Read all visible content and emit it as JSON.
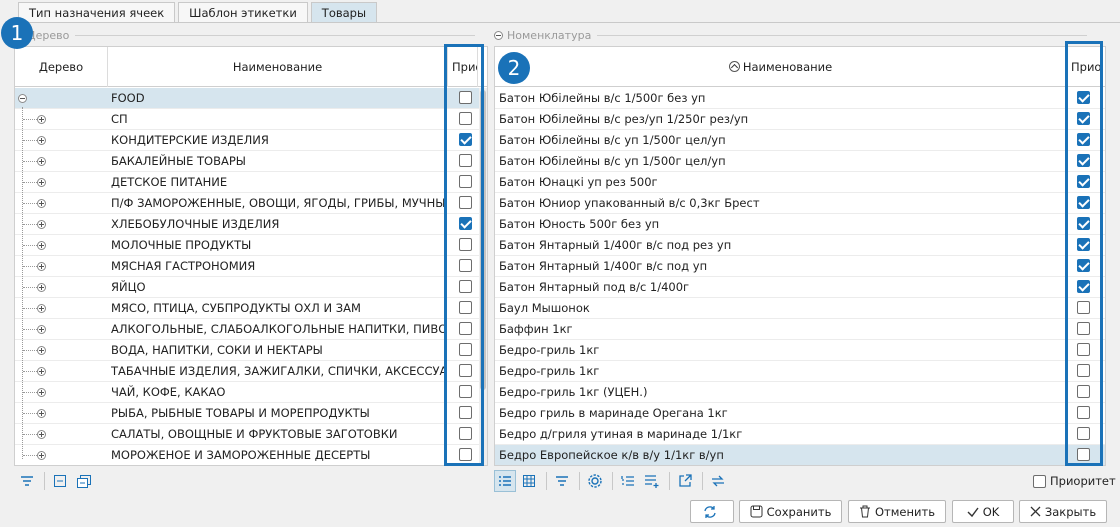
{
  "tabs": [
    {
      "label": "Тип назначения ячеек",
      "active": false
    },
    {
      "label": "Шаблон этикетки",
      "active": false
    },
    {
      "label": "Товары",
      "active": true
    }
  ],
  "badges": [
    "1",
    "2"
  ],
  "left_panel": {
    "legend": "Дерево",
    "columns": {
      "tree": "Дерево",
      "name": "Наименование",
      "priority": "Прио"
    },
    "rows": [
      {
        "name": "FOOD",
        "checked": false,
        "expanded": true
      },
      {
        "name": "СП",
        "checked": false
      },
      {
        "name": "КОНДИТЕРСКИЕ ИЗДЕЛИЯ",
        "checked": true
      },
      {
        "name": "БАКАЛЕЙНЫЕ ТОВАРЫ",
        "checked": false
      },
      {
        "name": "ДЕТСКОЕ ПИТАНИЕ",
        "checked": false
      },
      {
        "name": "П/Ф ЗАМОРОЖЕННЫЕ, ОВОЩИ, ЯГОДЫ, ГРИБЫ, МУЧНЫЕ",
        "checked": false
      },
      {
        "name": "ХЛЕБОБУЛОЧНЫЕ ИЗДЕЛИЯ",
        "checked": true
      },
      {
        "name": "МОЛОЧНЫЕ ПРОДУКТЫ",
        "checked": false
      },
      {
        "name": "МЯСНАЯ ГАСТРОНОМИЯ",
        "checked": false
      },
      {
        "name": "ЯЙЦО",
        "checked": false
      },
      {
        "name": "МЯСО, ПТИЦА, СУБПРОДУКТЫ ОХЛ И ЗАМ",
        "checked": false
      },
      {
        "name": "АЛКОГОЛЬНЫЕ, СЛАБОАЛКОГОЛЬНЫЕ НАПИТКИ, ПИВО",
        "checked": false
      },
      {
        "name": "ВОДА, НАПИТКИ, СОКИ И НЕКТАРЫ",
        "checked": false
      },
      {
        "name": "ТАБАЧНЫЕ ИЗДЕЛИЯ, ЗАЖИГАЛКИ, СПИЧКИ, АКСЕССУАРЫ",
        "checked": false
      },
      {
        "name": "ЧАЙ, КОФЕ, КАКАО",
        "checked": false
      },
      {
        "name": "РЫБА, РЫБНЫЕ ТОВАРЫ И МОРЕПРОДУКТЫ",
        "checked": false
      },
      {
        "name": "САЛАТЫ, ОВОЩНЫЕ И ФРУКТОВЫЕ ЗАГОТОВКИ",
        "checked": false
      },
      {
        "name": "МОРОЖЕНОЕ И ЗАМОРОЖЕННЫЕ ДЕСЕРТЫ",
        "checked": false
      }
    ]
  },
  "right_panel": {
    "legend": "Номенклатура",
    "columns": {
      "name": "Наименование",
      "priority": "Прио"
    },
    "rows": [
      {
        "name": "Батон Юбiлейны в/с 1/500г без уп",
        "checked": true
      },
      {
        "name": "Батон Юбiлейны в/с рез/уп 1/250г рез/уп",
        "checked": true
      },
      {
        "name": "Батон Юбiлейны в/с уп 1/500г цел/уп",
        "checked": true
      },
      {
        "name": "Батон Юбiлейны в/с уп 1/500г цел/уп",
        "checked": true
      },
      {
        "name": "Батон Юнацкі уп рез 500г",
        "checked": true
      },
      {
        "name": "Батон Юниор упакованный в/с 0,3кг Брест",
        "checked": true
      },
      {
        "name": "Батон Юность 500г без уп",
        "checked": true
      },
      {
        "name": "Батон Янтарный 1/400г в/с под рез уп",
        "checked": true
      },
      {
        "name": "Батон Янтарный 1/400г в/с под уп",
        "checked": true
      },
      {
        "name": "Батон Янтарный под в/с 1/400г",
        "checked": true
      },
      {
        "name": "Баул Мышонок",
        "checked": false
      },
      {
        "name": "Баффин 1кг",
        "checked": false
      },
      {
        "name": "Бедро-гриль 1кг",
        "checked": false
      },
      {
        "name": "Бедро-гриль 1кг",
        "checked": false
      },
      {
        "name": "Бедро-гриль 1кг (УЦЕН.)",
        "checked": false
      },
      {
        "name": "Бедро гриль в маринаде Орегана 1кг",
        "checked": false
      },
      {
        "name": "Бедро д/гриля утиная в маринаде 1/1кг",
        "checked": false
      },
      {
        "name": "Бедро Европейское к/в в/у 1/1кг в/уп",
        "checked": false
      }
    ],
    "priority_checkbox_label": "Приоритет"
  },
  "buttons": {
    "refresh": "",
    "save": "Сохранить",
    "cancel": "Отменить",
    "ok": "OK",
    "close": "Закрыть"
  },
  "colors": {
    "accent": "#1a72b8",
    "selection": "#d6e5ee"
  }
}
